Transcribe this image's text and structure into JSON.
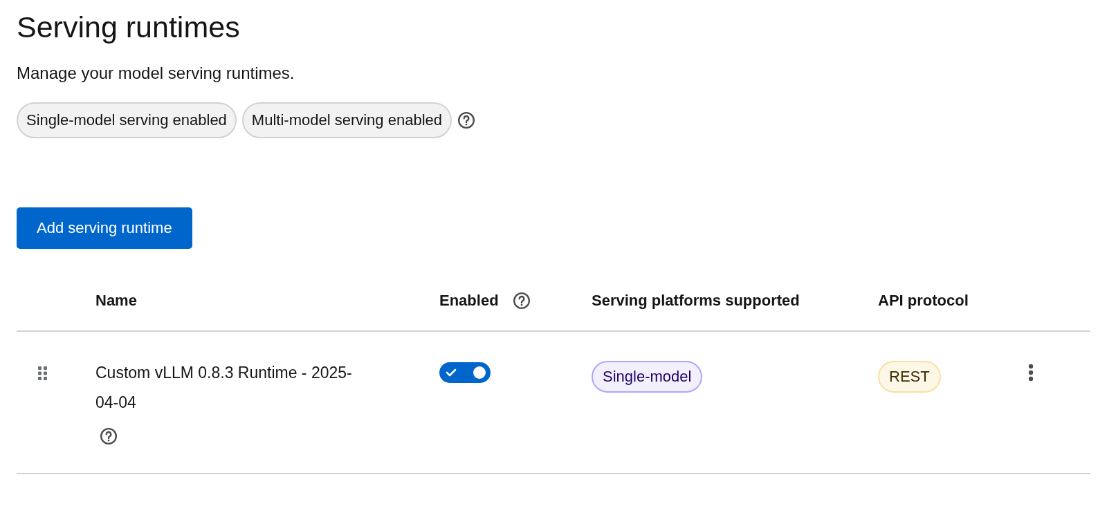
{
  "page": {
    "title": "Serving runtimes",
    "description": "Manage your model serving runtimes."
  },
  "serving_labels": [
    {
      "label": "Single-model serving enabled"
    },
    {
      "label": "Multi-model serving enabled"
    }
  ],
  "add_button": "Add serving runtime",
  "table": {
    "columns": [
      {
        "label": "Name",
        "help": false
      },
      {
        "label": "Enabled",
        "help": true
      },
      {
        "label": "Serving platforms supported",
        "help": false
      },
      {
        "label": "API protocol",
        "help": false
      }
    ],
    "rows": [
      {
        "name": "Custom vLLM 0.8.3 Runtime - 2025-04-04",
        "help": true,
        "enabled": true,
        "platforms": [
          "Single-model"
        ],
        "api_protocol": "REST"
      }
    ]
  }
}
